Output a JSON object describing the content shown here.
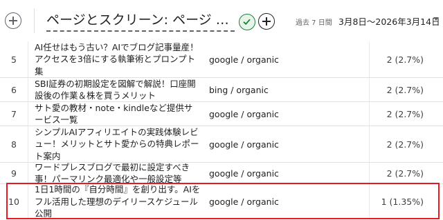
{
  "header": {
    "title": "ページとスクリーン: ページ タ...",
    "range_label": "過去 7 日間",
    "date_range": "3月8日〜2026年3月14日"
  },
  "icons": {
    "add_left": "add-circle-icon",
    "check": "check-circle-icon",
    "add_right": "add-circle-icon",
    "dropdown": "dropdown-arrow-icon"
  },
  "colors": {
    "highlight": "#e01b24",
    "check_green": "#188038"
  },
  "rows": [
    {
      "num": "5",
      "title": "AI任せはもう古い？AIでブログ記事量産！アクセスを3倍にする執筆術とプロンプト集",
      "source": "google / organic",
      "users": "2 (2.7%)"
    },
    {
      "num": "6",
      "title": "SBI証券の初期設定を図解で解説！口座開設後の作業＆株を買うメリット",
      "source": "bing / organic",
      "users": "2 (2.7%)"
    },
    {
      "num": "7",
      "title": "サト愛の教材・note・kindleなど提供サービス一覧",
      "source": "google / organic",
      "users": "2 (2.7%)"
    },
    {
      "num": "8",
      "title": "シンプルAIアフィリエイトの実践体験レビュー！メリットとサト愛からの特典レポート案内",
      "source": "google / organic",
      "users": "2 (2.7%)"
    },
    {
      "num": "9",
      "title": "ワードプレスブログで最初に設定すべき事！パーマリンク最適化や一般設定等",
      "source": "google / organic",
      "users": "2 (2.7%)"
    },
    {
      "num": "10",
      "title": "1日1時間の『自分時間』を創り出す。AIをフル活用した理想のデイリースケジュール公開",
      "source": "google / organic",
      "users": "1 (1.35%)"
    }
  ]
}
